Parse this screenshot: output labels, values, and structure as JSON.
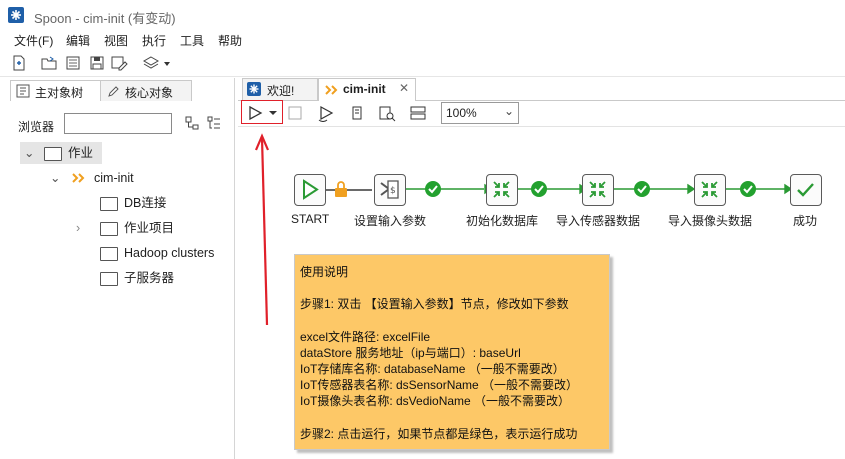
{
  "window": {
    "title": "Spoon - cim-init (有变动)"
  },
  "menu": [
    "文件(F)",
    "编辑",
    "视图",
    "执行",
    "工具",
    "帮助"
  ],
  "left_panel": {
    "tabs": [
      {
        "label": "主对象树"
      },
      {
        "label": "核心对象"
      }
    ],
    "search_label": "浏览器",
    "search_value": "",
    "tree": {
      "root": "作业",
      "job": "cim-init",
      "children": [
        "DB连接",
        "作业项目",
        "Hadoop clusters",
        "子服务器"
      ]
    }
  },
  "canvas": {
    "tabs": [
      {
        "label": "欢迎!"
      },
      {
        "label": "cim-init"
      }
    ],
    "zoom": "100%",
    "nodes": [
      {
        "label": "START"
      },
      {
        "label": "设置输入参数"
      },
      {
        "label": "初始化数据库"
      },
      {
        "label": "导入传感器数据"
      },
      {
        "label": "导入摄像头数据"
      },
      {
        "label": "成功"
      }
    ],
    "note": {
      "lines": [
        "使用说明",
        "",
        "步骤1:  双击 【设置输入参数】节点，修改如下参数",
        "",
        "excel文件路径:  excelFile",
        "dataStore 服务地址（ip与端口）: baseUrl",
        "IoT存储库名称: databaseName  （一般不需要改）",
        "IoT传感器表名称: dsSensorName  （一般不需要改）",
        "IoT摄像头表名称: dsVedioName  （一般不需要改）",
        "",
        "步骤2: 点击运行，如果节点都是绿色，表示运行成功"
      ]
    }
  },
  "colors": {
    "accent": "#1f5fa8",
    "ok_green": "#23a12f",
    "note_bg": "#fdc867",
    "annotation_red": "#e0202a"
  }
}
